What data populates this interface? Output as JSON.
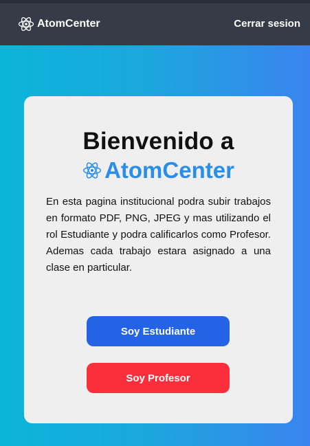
{
  "navbar": {
    "brand_label": "AtomCenter",
    "brand_icon": "atom-icon",
    "logout_label": "Cerrar sesion"
  },
  "welcome": {
    "title_line1": "Bienvenido a",
    "title_brand": "AtomCenter",
    "title_icon": "atom-icon",
    "description": "En esta pagina institucional podra subir trabajos en formato PDF, PNG, JPEG y mas utilizando el rol Estudiante y podra calificarlos como Profesor. Ademas cada trabajo estara asignado a una clase en particular.",
    "student_button": "Soy Estudiante",
    "teacher_button": "Soy Profesor"
  },
  "colors": {
    "navbar_bg": "#353b47",
    "brand_blue": "#2a8ee8",
    "student_button": "#2563e6",
    "teacher_button": "#fb2f3c",
    "gradient_start": "#0bb5d8",
    "gradient_end": "#3a84ef"
  }
}
